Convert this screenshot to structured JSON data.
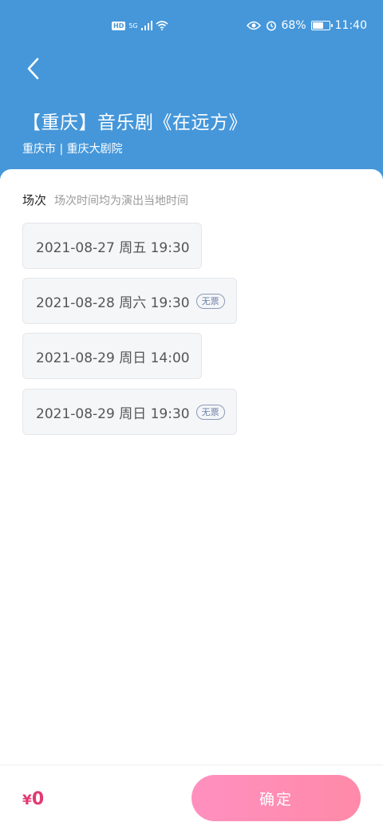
{
  "status_bar": {
    "left_badges": [
      "HD",
      "5G"
    ],
    "battery": "68%",
    "battery_level": 0.68,
    "time": "11:40"
  },
  "header": {
    "back_icon": "chevron-left-icon",
    "title": "【重庆】音乐剧《在远方》",
    "subtitle": "重庆市 | 重庆大剧院",
    "background": "#4597da"
  },
  "sessions_section": {
    "title": "场次",
    "note": "场次时间均为演出当地时间",
    "items": [
      {
        "label": "2021-08-27 周五 19:30",
        "badge": ""
      },
      {
        "label": "2021-08-28 周六 19:30",
        "badge": "无票"
      },
      {
        "label": "2021-08-29 周日 14:00",
        "badge": ""
      },
      {
        "label": "2021-08-29 周日 19:30",
        "badge": "无票"
      }
    ]
  },
  "footer": {
    "currency": "¥",
    "price": "0",
    "confirm_label": "确定",
    "accent": "#e23a73"
  }
}
